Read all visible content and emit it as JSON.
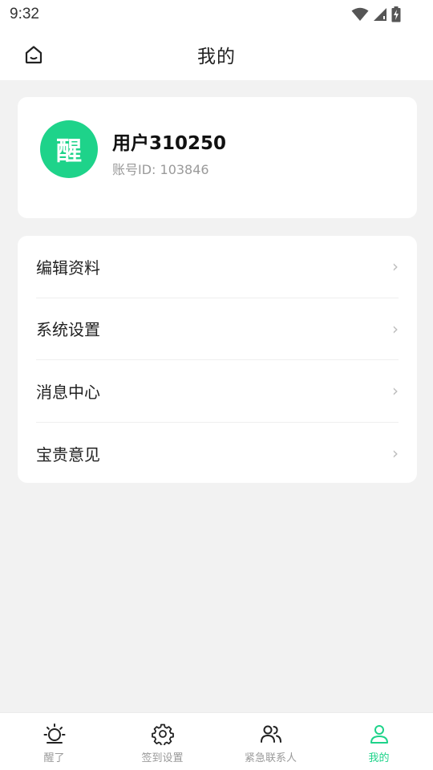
{
  "status_bar": {
    "time": "9:32"
  },
  "header": {
    "title": "我的"
  },
  "profile": {
    "avatar_text": "醒",
    "user_name": "用户310250",
    "account_id": "账号ID: 103846"
  },
  "menu": {
    "items": [
      {
        "label": "编辑资料"
      },
      {
        "label": "系统设置"
      },
      {
        "label": "消息中心"
      },
      {
        "label": "宝贵意见"
      }
    ]
  },
  "tabs": [
    {
      "label": "醒了",
      "icon": "sun-icon"
    },
    {
      "label": "签到设置",
      "icon": "gear-icon"
    },
    {
      "label": "紧急联系人",
      "icon": "contacts-icon"
    },
    {
      "label": "我的",
      "icon": "user-icon",
      "active": true
    }
  ],
  "colors": {
    "accent": "#1ed38a",
    "background": "#f2f2f2",
    "inactive_text": "#9a9a9a"
  }
}
